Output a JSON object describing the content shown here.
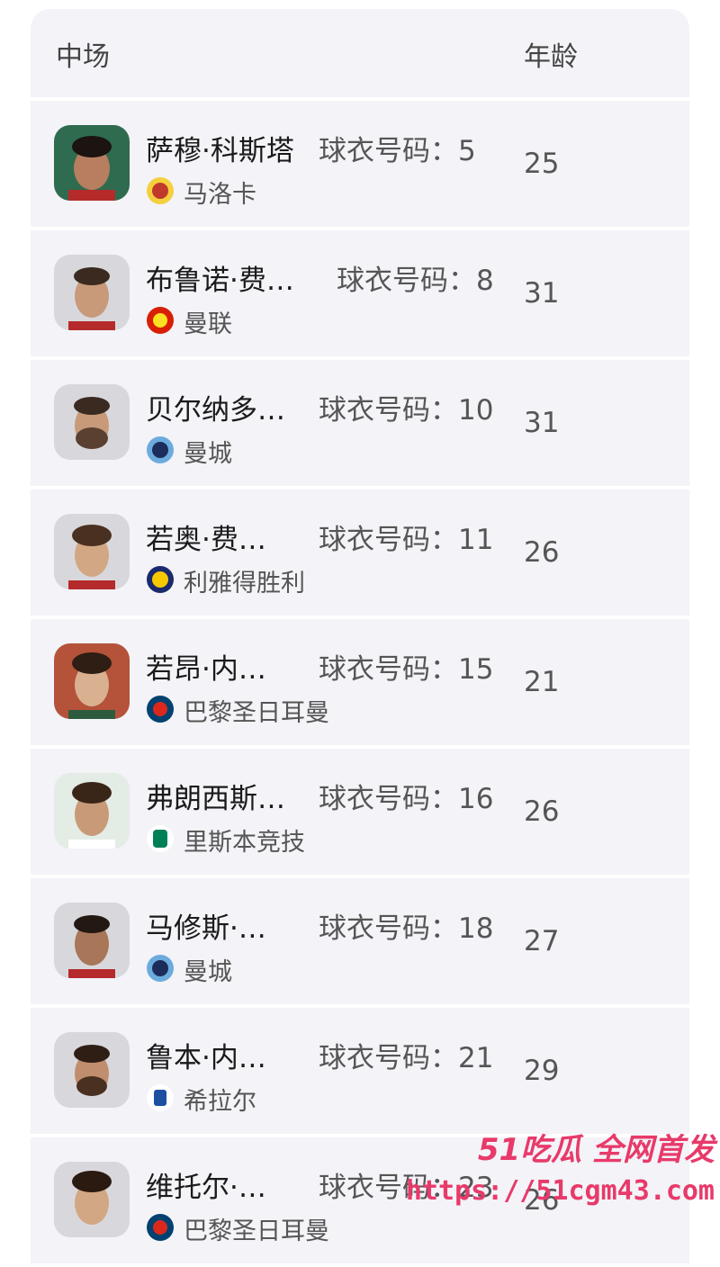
{
  "header": {
    "position_label": "中场",
    "age_label": "年龄"
  },
  "jersey_prefix": "球衣号码：",
  "players": [
    {
      "name": "萨穆·科斯塔",
      "number": "5",
      "club": "马洛卡",
      "age": "25",
      "club_icon": "mallorca-crest-icon"
    },
    {
      "name": "布鲁诺·费…",
      "number": "8",
      "club": "曼联",
      "age": "31",
      "club_icon": "man-utd-crest-icon"
    },
    {
      "name": "贝尔纳多…",
      "number": "10",
      "club": "曼城",
      "age": "31",
      "club_icon": "man-city-crest-icon"
    },
    {
      "name": "若奥·费…",
      "number": "11",
      "club": "利雅得胜利",
      "age": "26",
      "club_icon": "al-nassr-crest-icon"
    },
    {
      "name": "若昂·内…",
      "number": "15",
      "club": "巴黎圣日耳曼",
      "age": "21",
      "club_icon": "psg-crest-icon"
    },
    {
      "name": "弗朗西斯…",
      "number": "16",
      "club": "里斯本竞技",
      "age": "26",
      "club_icon": "sporting-crest-icon"
    },
    {
      "name": "马修斯·…",
      "number": "18",
      "club": "曼城",
      "age": "27",
      "club_icon": "man-city-crest-icon"
    },
    {
      "name": "鲁本·内…",
      "number": "21",
      "club": "希拉尔",
      "age": "29",
      "club_icon": "al-hilal-crest-icon"
    },
    {
      "name": "维托尔·…",
      "number": "23",
      "club": "巴黎圣日耳曼",
      "age": "26",
      "club_icon": "psg-crest-icon"
    }
  ],
  "watermark": {
    "tagline": "51吃瓜 全网首发",
    "url": "https://51cgm43.com"
  },
  "colors": {
    "row_bg": "#f3f3f8",
    "watermark": "#e83a6a"
  }
}
